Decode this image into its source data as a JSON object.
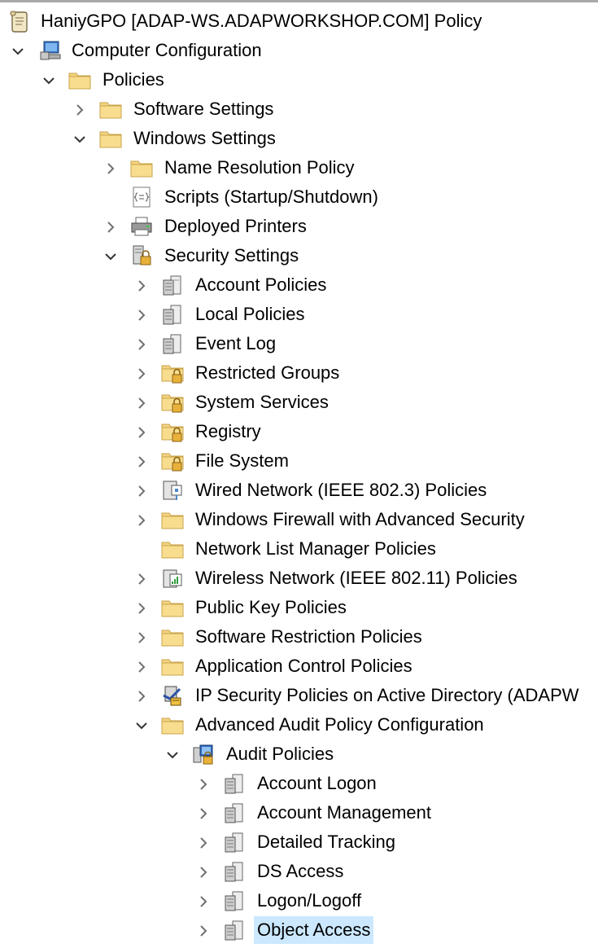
{
  "tree": {
    "root": {
      "label": "HaniyGPO [ADAP-WS.ADAPWORKSHOP.COM] Policy",
      "icon": "scroll-document-icon"
    },
    "computer_configuration": {
      "label": "Computer Configuration",
      "icon": "computer-icon",
      "expanded": true
    },
    "policies": {
      "label": "Policies",
      "icon": "folder-icon",
      "expanded": true
    },
    "software_settings": {
      "label": "Software Settings",
      "icon": "folder-icon",
      "expanded": false
    },
    "windows_settings": {
      "label": "Windows Settings",
      "icon": "folder-icon",
      "expanded": true
    },
    "windows_settings_items": [
      {
        "label": "Name Resolution Policy",
        "icon": "folder-icon"
      },
      {
        "label": "Scripts (Startup/Shutdown)",
        "icon": "script-icon"
      },
      {
        "label": "Deployed Printers",
        "icon": "printer-icon"
      },
      {
        "label": "Security Settings",
        "icon": "security-settings-icon",
        "expanded": true
      }
    ],
    "security_items": [
      {
        "label": "Account Policies",
        "icon": "policy-server-icon"
      },
      {
        "label": "Local Policies",
        "icon": "policy-server-icon"
      },
      {
        "label": "Event Log",
        "icon": "policy-server-icon"
      },
      {
        "label": "Restricted Groups",
        "icon": "locked-folder-icon"
      },
      {
        "label": "System Services",
        "icon": "locked-folder-icon"
      },
      {
        "label": "Registry",
        "icon": "locked-folder-icon"
      },
      {
        "label": "File System",
        "icon": "locked-folder-icon"
      },
      {
        "label": "Wired Network (IEEE 802.3) Policies",
        "icon": "wired-network-icon"
      },
      {
        "label": "Windows Firewall with Advanced Security",
        "icon": "folder-icon"
      },
      {
        "label": "Network List Manager Policies",
        "icon": "folder-icon"
      },
      {
        "label": "Wireless Network (IEEE 802.11) Policies",
        "icon": "wireless-network-icon"
      },
      {
        "label": "Public Key Policies",
        "icon": "folder-icon"
      },
      {
        "label": "Software Restriction Policies",
        "icon": "folder-icon"
      },
      {
        "label": "Application Control Policies",
        "icon": "folder-icon"
      },
      {
        "label": "IP Security Policies on Active Directory (ADAPW",
        "icon": "ip-security-icon"
      },
      {
        "label": "Advanced Audit Policy Configuration",
        "icon": "folder-icon",
        "expanded": true
      }
    ],
    "audit_policies": {
      "label": "Audit Policies",
      "icon": "audit-policies-icon",
      "expanded": true
    },
    "audit_items": [
      {
        "label": "Account Logon",
        "icon": "policy-server-icon"
      },
      {
        "label": "Account Management",
        "icon": "policy-server-icon"
      },
      {
        "label": "Detailed Tracking",
        "icon": "policy-server-icon"
      },
      {
        "label": "DS Access",
        "icon": "policy-server-icon"
      },
      {
        "label": "Logon/Logoff",
        "icon": "policy-server-icon"
      },
      {
        "label": "Object Access",
        "icon": "policy-server-icon",
        "selected": true
      }
    ]
  },
  "colors": {
    "selection": "#cce8ff",
    "folder": "#f3d382",
    "chevron": "#707070"
  }
}
